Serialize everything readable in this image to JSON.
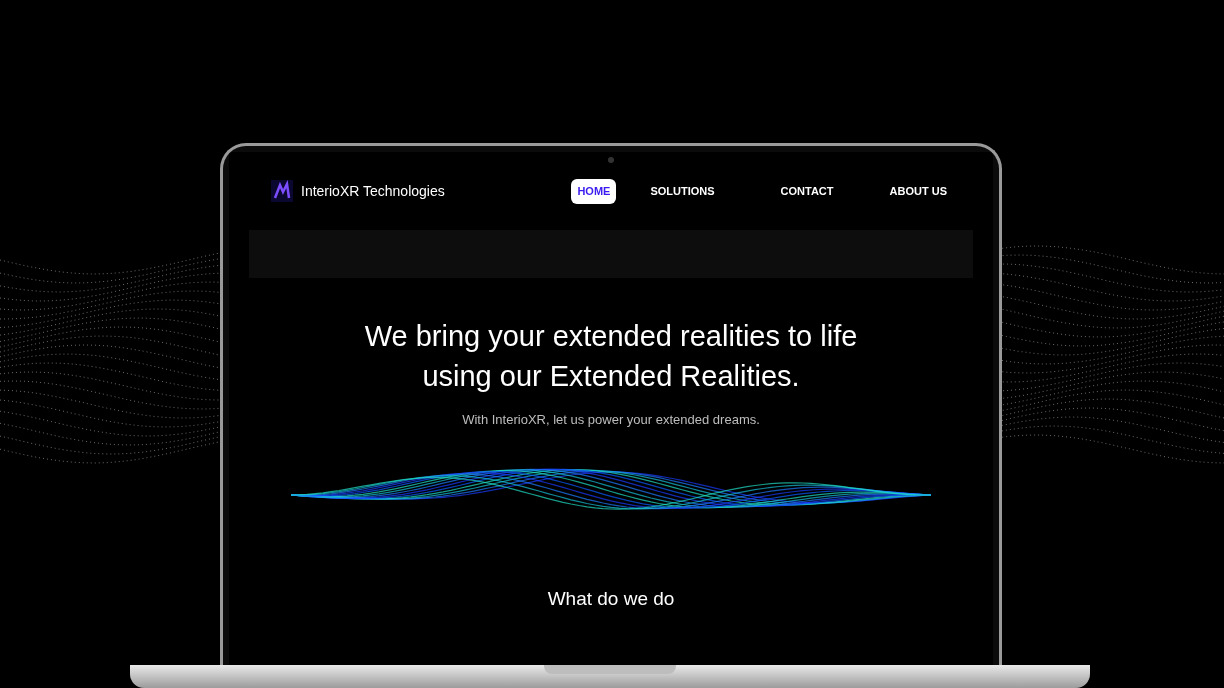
{
  "site": {
    "brand": "InterioXR Technologies"
  },
  "nav": [
    {
      "label": "HOME",
      "selected": true
    },
    {
      "label": "SOLUTIONS",
      "selected": false
    },
    {
      "label": "CONTACT",
      "selected": false
    },
    {
      "label": "ABOUT US",
      "selected": false
    }
  ],
  "hero": {
    "headline": "We bring your extended realities to life using our Extended Realities.",
    "subtitle": "With InterioXR, let us power your extended dreams."
  },
  "section": {
    "heading": "What do we do"
  }
}
